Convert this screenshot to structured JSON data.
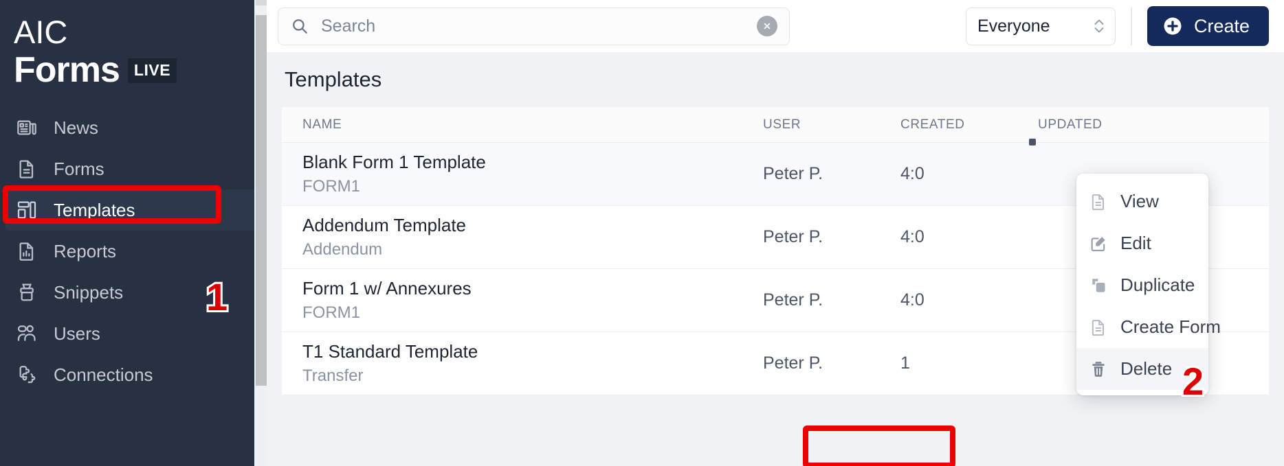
{
  "sidebar": {
    "brand": {
      "line1": "AIC",
      "line2": "Forms",
      "badge": "LIVE"
    },
    "items": [
      {
        "label": "News",
        "icon": "news-icon",
        "active": false
      },
      {
        "label": "Forms",
        "icon": "document-icon",
        "active": false
      },
      {
        "label": "Templates",
        "icon": "layout-icon",
        "active": true
      },
      {
        "label": "Reports",
        "icon": "report-icon",
        "active": false
      },
      {
        "label": "Snippets",
        "icon": "snippet-icon",
        "active": false
      },
      {
        "label": "Users",
        "icon": "users-icon",
        "active": false
      },
      {
        "label": "Connections",
        "icon": "connections-icon",
        "active": false
      }
    ]
  },
  "toolbar": {
    "search": {
      "placeholder": "Search",
      "value": "",
      "icon": "search-icon",
      "clear_icon": "clear-circle-icon"
    },
    "audience_select": {
      "value": "Everyone",
      "icon": "chevron-updown-icon"
    },
    "create_button": {
      "label": "Create",
      "icon": "plus-circle-icon",
      "color": "#152a5c"
    }
  },
  "main": {
    "page_title": "Templates",
    "table": {
      "columns": [
        "NAME",
        "USER",
        "CREATED",
        "UPDATED"
      ],
      "rows": [
        {
          "name": "Blank Form 1 Template",
          "sub": "FORM1",
          "user": "Peter P.",
          "created": "4:0",
          "updated": "",
          "hover": true
        },
        {
          "name": "Addendum Template",
          "sub": "Addendum",
          "user": "Peter P.",
          "created": "4:0",
          "updated": "",
          "hover": false
        },
        {
          "name": "Form 1 w/ Annexures",
          "sub": "FORM1",
          "user": "Peter P.",
          "created": "4:0",
          "updated": "",
          "hover": false
        },
        {
          "name": "T1 Standard Template",
          "sub": "Transfer",
          "user": "Peter P.",
          "created": "1",
          "updated": "",
          "hover": false
        }
      ]
    }
  },
  "context_menu": {
    "items": [
      {
        "label": "View",
        "icon": "document-view-icon",
        "highlight": false
      },
      {
        "label": "Edit",
        "icon": "pencil-square-icon",
        "highlight": false
      },
      {
        "label": "Duplicate",
        "icon": "copy-icon",
        "highlight": false
      },
      {
        "label": "Create Form",
        "icon": "document-plus-icon",
        "highlight": false
      },
      {
        "label": "Delete",
        "icon": "trash-icon",
        "highlight": true
      }
    ]
  },
  "annotations": {
    "step1": "1",
    "step2": "2",
    "color": "#ee0000"
  }
}
